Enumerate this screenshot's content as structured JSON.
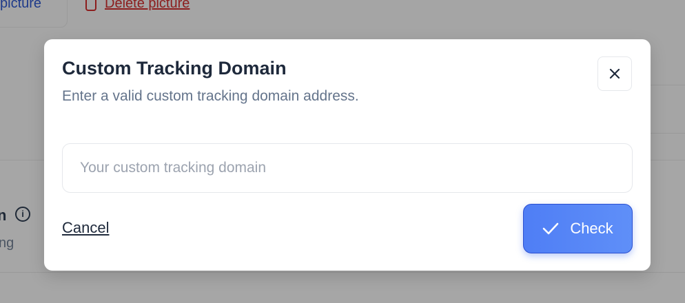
{
  "background": {
    "change_picture_label": "picture",
    "delete_picture_label": "Delete picture",
    "row_title_fragment": "n",
    "row_subtitle_fragment": "ng",
    "info_icon": "info-icon",
    "info_glyph": "i"
  },
  "modal": {
    "title": "Custom Tracking Domain",
    "subtitle": "Enter a valid custom tracking domain address.",
    "close_icon": "close-icon",
    "input": {
      "placeholder": "Your custom tracking domain",
      "value": ""
    },
    "cancel_label": "Cancel",
    "check_label": "Check",
    "check_icon": "checkmark-icon"
  },
  "colors": {
    "primary": "#4f7ef5",
    "title": "#1e293b",
    "muted": "#64748b",
    "danger": "#8c1d1d"
  }
}
